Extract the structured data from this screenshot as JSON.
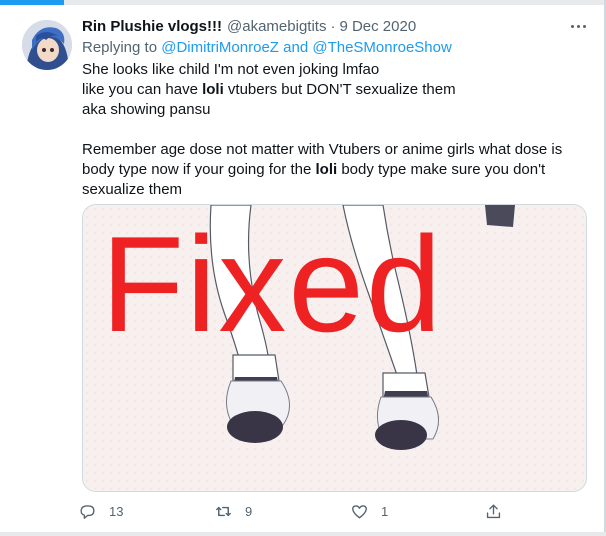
{
  "tweet": {
    "display_name": "Rin Plushie vlogs!!!",
    "handle": "@akamebigtits",
    "separator": "·",
    "date": "9 Dec 2020",
    "reply_prefix": "Replying to",
    "reply_user_1": "@DimitriMonroeZ",
    "reply_and": "and",
    "reply_user_2": "@TheSMonroeShow",
    "lines": {
      "l1": "She looks like child I'm not even joking lmfao",
      "l2_a": "like you can have ",
      "l2_b": "loli",
      "l2_c": " vtubers but DON'T sexualize them",
      "l3": "aka showing pansu",
      "l4": "Remember age dose not matter with Vtubers or anime girls what dose is",
      "l5_a": "body type now if your going for the ",
      "l5_b": "loli",
      "l5_c": " body type make sure you don't",
      "l6": "sexualize them"
    },
    "media_text": "Fixed",
    "counts": {
      "replies": "13",
      "retweets": "9",
      "likes": "1"
    }
  },
  "icons": {
    "more": "more-dots-icon",
    "reply": "reply-bubble-icon",
    "retweet": "retweet-icon",
    "like": "heart-icon",
    "share": "share-icon"
  },
  "colors": {
    "link": "#1d9bf0",
    "secondary_text": "#536471",
    "primary_text": "#0f1419",
    "media_overlay_text": "#ee2222"
  }
}
